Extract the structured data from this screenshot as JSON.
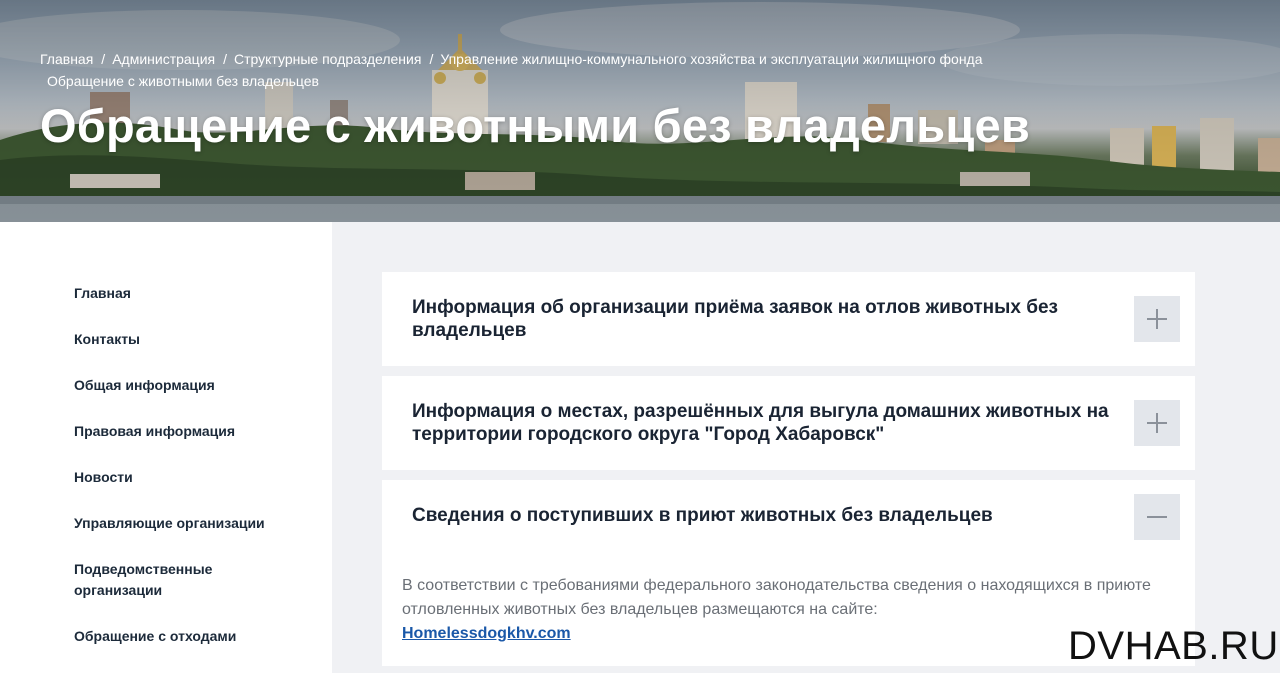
{
  "breadcrumb": {
    "items": [
      "Главная",
      "Администрация",
      "Структурные подразделения",
      "Управление жилищно-коммунального хозяйства и эксплуатации жилищного фонда"
    ],
    "separator": "/",
    "current": "Обращение с животными без владельцев"
  },
  "page_title": "Обращение с животными без владельцев",
  "sidebar": {
    "items": [
      {
        "label": "Главная"
      },
      {
        "label": "Контакты"
      },
      {
        "label": "Общая информация"
      },
      {
        "label": "Правовая информация"
      },
      {
        "label": "Новости"
      },
      {
        "label": "Управляющие организации"
      },
      {
        "label": "Подведомственные организации"
      },
      {
        "label": "Обращение с отходами"
      }
    ]
  },
  "accordion": [
    {
      "title": "Информация об организации приёма заявок на отлов животных без владельцев",
      "expanded": false,
      "toggle_icon": "plus-icon"
    },
    {
      "title": "Информация о местах, разрешённых для выгула домашних животных на территории городского округа \"Город Хабаровск\"",
      "expanded": false,
      "toggle_icon": "plus-icon"
    },
    {
      "title": "Сведения о поступивших в приют животных без владельцев",
      "expanded": true,
      "toggle_icon": "minus-icon",
      "body_text": "В соответствии с требованиями федерального законодательства сведения о находящихся в приюте отловленных животных без владельцев размещаются на сайте:",
      "link_text": "Homelessdogkhv.com"
    }
  ],
  "watermark": "DVHAB.RU",
  "colors": {
    "title_text": "#1a2433",
    "link": "#1a58a8",
    "toggle_bg": "#e3e6eb",
    "page_bg": "#f0f1f4"
  }
}
